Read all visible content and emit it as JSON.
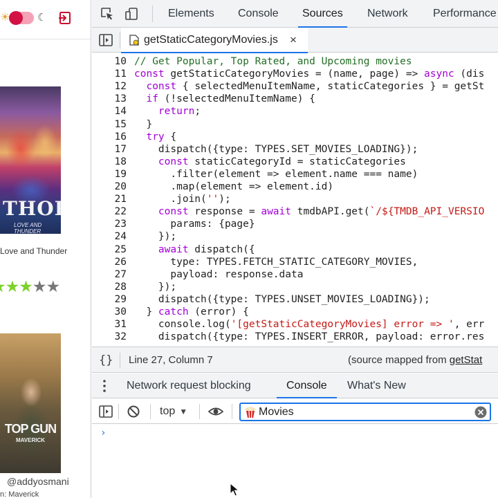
{
  "website": {
    "movies": [
      {
        "title": "Love and Thunder",
        "poster_title": "THOR",
        "poster_subtitle": "LOVE AND THUNDER",
        "rating_filled": 3,
        "rating_total": 5
      },
      {
        "poster_title": "TOP GUN",
        "poster_subtitle": "MAVERICK",
        "caption": "n: Maverick"
      }
    ],
    "watermark": "@addyosmani"
  },
  "devtools": {
    "tabs": [
      "Elements",
      "Console",
      "Sources",
      "Network",
      "Performance"
    ],
    "active_tab": "Sources",
    "file_tab": {
      "name": "getStaticCategoryMovies.js",
      "close": "×"
    },
    "code_lines": [
      {
        "n": "10",
        "segs": [
          [
            "c",
            "// Get Popular, Top Rated, and Upcoming movies"
          ]
        ]
      },
      {
        "n": "11",
        "segs": [
          [
            "k",
            "const"
          ],
          [
            "p",
            " getStaticCategoryMovies = (name, page) => "
          ],
          [
            "k",
            "async"
          ],
          [
            "p",
            " (dis"
          ]
        ]
      },
      {
        "n": "12",
        "segs": [
          [
            "p",
            "  "
          ],
          [
            "k",
            "const"
          ],
          [
            "p",
            " { selectedMenuItemName, staticCategories } = getSt"
          ]
        ]
      },
      {
        "n": "13",
        "segs": [
          [
            "p",
            "  "
          ],
          [
            "k",
            "if"
          ],
          [
            "p",
            " (!selectedMenuItemName) {"
          ]
        ]
      },
      {
        "n": "14",
        "segs": [
          [
            "p",
            "    "
          ],
          [
            "k",
            "return"
          ],
          [
            "p",
            ";"
          ]
        ]
      },
      {
        "n": "15",
        "segs": [
          [
            "p",
            "  }"
          ]
        ]
      },
      {
        "n": "16",
        "segs": [
          [
            "p",
            "  "
          ],
          [
            "k",
            "try"
          ],
          [
            "p",
            " {"
          ]
        ]
      },
      {
        "n": "17",
        "segs": [
          [
            "p",
            "    dispatch({type: TYPES.SET_MOVIES_LOADING});"
          ]
        ]
      },
      {
        "n": "18",
        "segs": [
          [
            "p",
            "    "
          ],
          [
            "k",
            "const"
          ],
          [
            "p",
            " staticCategoryId = staticCategories"
          ]
        ]
      },
      {
        "n": "19",
        "segs": [
          [
            "p",
            "      .filter(element => element.name === name)"
          ]
        ]
      },
      {
        "n": "20",
        "segs": [
          [
            "p",
            "      .map(element => element.id)"
          ]
        ]
      },
      {
        "n": "21",
        "segs": [
          [
            "p",
            "      .join("
          ],
          [
            "s",
            "''"
          ],
          [
            "p",
            ");"
          ]
        ]
      },
      {
        "n": "22",
        "segs": [
          [
            "p",
            "    "
          ],
          [
            "k",
            "const"
          ],
          [
            "p",
            " response = "
          ],
          [
            "k",
            "await"
          ],
          [
            "p",
            " tmdbAPI.get("
          ],
          [
            "s",
            "`/${TMDB_API_VERSIO"
          ]
        ]
      },
      {
        "n": "23",
        "segs": [
          [
            "p",
            "      params: {page}"
          ]
        ]
      },
      {
        "n": "24",
        "segs": [
          [
            "p",
            "    });"
          ]
        ]
      },
      {
        "n": "25",
        "segs": [
          [
            "p",
            "    "
          ],
          [
            "k",
            "await"
          ],
          [
            "p",
            " dispatch({"
          ]
        ]
      },
      {
        "n": "26",
        "segs": [
          [
            "p",
            "      type: TYPES.FETCH_STATIC_CATEGORY_MOVIES,"
          ]
        ]
      },
      {
        "n": "27",
        "segs": [
          [
            "p",
            "      payload: response.data"
          ]
        ]
      },
      {
        "n": "28",
        "segs": [
          [
            "p",
            "    });"
          ]
        ]
      },
      {
        "n": "29",
        "segs": [
          [
            "p",
            "    dispatch({type: TYPES.UNSET_MOVIES_LOADING});"
          ]
        ]
      },
      {
        "n": "30",
        "segs": [
          [
            "p",
            "  } "
          ],
          [
            "k",
            "catch"
          ],
          [
            "p",
            " (error) {"
          ]
        ]
      },
      {
        "n": "31",
        "segs": [
          [
            "p",
            "    console.log("
          ],
          [
            "s",
            "'[getStaticCategoryMovies] error => '"
          ],
          [
            "p",
            ", err"
          ]
        ]
      },
      {
        "n": "32",
        "segs": [
          [
            "p",
            "    dispatch({type: TYPES.INSERT_ERROR, payload: error.res"
          ]
        ]
      }
    ],
    "status": {
      "braces": "{}",
      "position": "Line 27, Column 7",
      "source_mapped_prefix": "(source mapped from ",
      "source_mapped_link": "getStat"
    },
    "drawer_tabs": [
      "Network request blocking",
      "Console",
      "What's New"
    ],
    "active_drawer_tab": "Console",
    "console": {
      "context": "top",
      "filter_value": "Movies",
      "prompt": "›"
    },
    "colors": {
      "accent": "#1a73e8",
      "keyword": "#a100d4",
      "comment": "#236e25",
      "string": "#c41a16",
      "toggle": "#d21144",
      "star_on": "#7dd12a"
    }
  }
}
